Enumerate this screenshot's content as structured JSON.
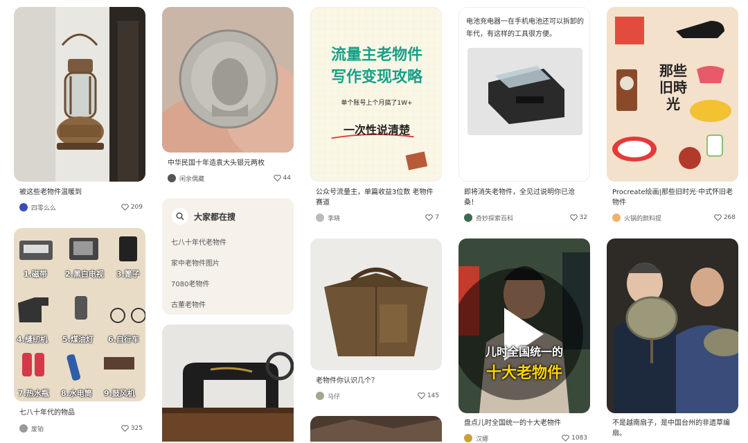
{
  "cards": [
    {
      "id": "lantern",
      "title": "被这些老物件温暖到",
      "author": "四零么么",
      "likes": "209"
    },
    {
      "id": "coin",
      "title": "中华民国十年造袁大头银元两枚",
      "author": "闲余偶藏",
      "likes": "44"
    },
    {
      "id": "guide",
      "title": "公众号流量主，单篇收益3位数 老物件赛道",
      "author": "李晓",
      "likes": "7",
      "poster": {
        "line1": "流量主老物件",
        "line2": "写作变现攻略",
        "sub": "单个账号上个月搞了1W+",
        "tag": "一次性说清楚"
      }
    },
    {
      "id": "charger",
      "title": "即将消失老物件，全见过说明你已沧桑！",
      "author": "奇妙探索百科",
      "likes": "32",
      "caption": "电池充电器一在手机电池还可以拆卸的年代，有这样的工具很方便。"
    },
    {
      "id": "procreate",
      "title": "Procreate绘画|那些旧时光·中式怀旧老物件",
      "author": "火锅的颜料提",
      "likes": "268",
      "poster": {
        "text": "那些\n旧時\n光"
      }
    },
    {
      "id": "seventies",
      "title": "七八十年代的物品",
      "author": "废铂",
      "likes": "325",
      "grid": [
        "1.磁带",
        "2.黑白电视",
        "3.篦子",
        "4.缝纫机",
        "5.煤油灯",
        "6.自行车",
        "7.热水瓶",
        "8.水电筒",
        "9.鼓风机"
      ]
    },
    {
      "id": "box",
      "title": "老物件你认识几个？",
      "author": "马仔",
      "likes": "145"
    },
    {
      "id": "video",
      "title": "盘点儿时全国统一的十大老物件",
      "author": "汉娜",
      "likes": "1083",
      "poster": {
        "line1": "儿时全国统一的",
        "line2": "十大老物件"
      }
    },
    {
      "id": "fans",
      "title": "不是越南扇子，是中国台州的非遗草编扇。",
      "author": "",
      "likes": ""
    }
  ],
  "search": {
    "title": "大家都在搜",
    "items": [
      "七八十年代老物件",
      "家中老物件图片",
      "7080老物件",
      "古董老物件"
    ]
  },
  "colors": {
    "panel_bg": "#f6f1eb",
    "accent_red": "#e23b3b",
    "poster_teal": "#16a08a"
  }
}
